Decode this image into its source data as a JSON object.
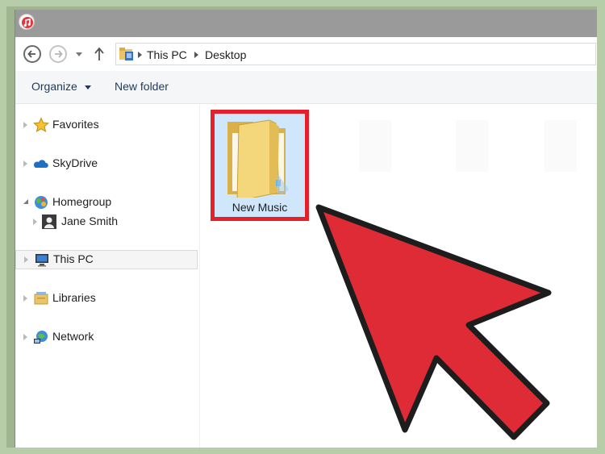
{
  "window": {
    "title": ""
  },
  "address": {
    "crumbs": [
      "This PC",
      "Desktop"
    ]
  },
  "toolbar": {
    "organize_label": "Organize",
    "new_folder_label": "New folder"
  },
  "sidebar": {
    "items": [
      {
        "label": "Favorites",
        "icon": "star-icon"
      },
      {
        "label": "SkyDrive",
        "icon": "cloud-icon"
      },
      {
        "label": "Homegroup",
        "icon": "homegroup-icon"
      },
      {
        "label": "Jane Smith",
        "icon": "user-icon"
      },
      {
        "label": "This PC",
        "icon": "computer-icon"
      },
      {
        "label": "Libraries",
        "icon": "libraries-icon"
      },
      {
        "label": "Network",
        "icon": "network-icon"
      }
    ]
  },
  "content": {
    "items": [
      {
        "label": "New Music",
        "icon": "folder-icon"
      }
    ]
  },
  "colors": {
    "highlight_border": "#e4212a",
    "arrow_fill": "#df2b35",
    "selection_bg": "#cfe6fb"
  }
}
